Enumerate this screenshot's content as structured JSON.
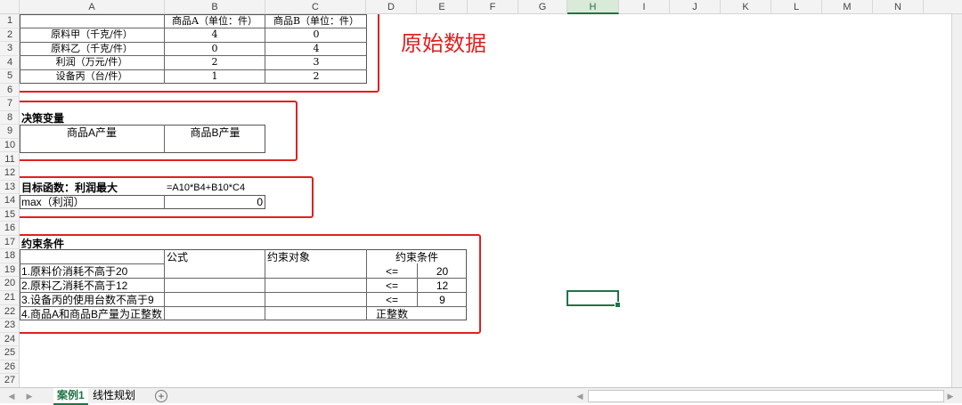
{
  "columns": [
    "A",
    "B",
    "C",
    "D",
    "E",
    "F",
    "G",
    "H",
    "I",
    "J",
    "K",
    "L",
    "M",
    "N"
  ],
  "selected_column": "H",
  "rows": [
    "1",
    "2",
    "3",
    "4",
    "5",
    "6",
    "7",
    "8",
    "9",
    "10",
    "11",
    "12",
    "13",
    "14",
    "15",
    "16",
    "17",
    "18",
    "19",
    "20",
    "21",
    "22",
    "23",
    "24",
    "25",
    "26",
    "27"
  ],
  "raw_data": {
    "header_b": "商品A（单位：件）",
    "header_c": "商品B（单位：件）",
    "rows": [
      {
        "label": "原料甲（千克/件）",
        "b": "4",
        "c": "0"
      },
      {
        "label": "原料乙（千克/件）",
        "b": "0",
        "c": "4"
      },
      {
        "label": "利润（万元/件）",
        "b": "2",
        "c": "3"
      },
      {
        "label": "设备丙（台/件）",
        "b": "1",
        "c": "2"
      }
    ]
  },
  "annotation": "原始数据",
  "decision": {
    "title": "决策变量",
    "var_a": "商品A产量",
    "var_b": "商品B产量"
  },
  "objective": {
    "title": "目标函数：利润最大",
    "formula": "=A10*B4+B10*C4",
    "label": "max（利润）",
    "value": "0"
  },
  "constraints": {
    "title": "约束条件",
    "col_formula": "公式",
    "col_target": "约束对象",
    "col_condition": "约束条件",
    "rows": [
      {
        "label": "1.原料价消耗不高于20",
        "op": "<=",
        "limit": "20"
      },
      {
        "label": "2.原料乙消耗不高于12",
        "op": "<=",
        "limit": "12"
      },
      {
        "label": "3.设备丙的使用台数不高于9",
        "op": "<=",
        "limit": "9"
      },
      {
        "label": "4.商品A和商品B产量为正整数",
        "op": "正整数",
        "limit": ""
      }
    ]
  },
  "sheets": [
    {
      "name": "案例1",
      "active": true
    },
    {
      "name": "线性规划",
      "active": false
    }
  ],
  "colors": {
    "accent": "#217346",
    "annotation_red": "#e02020"
  }
}
